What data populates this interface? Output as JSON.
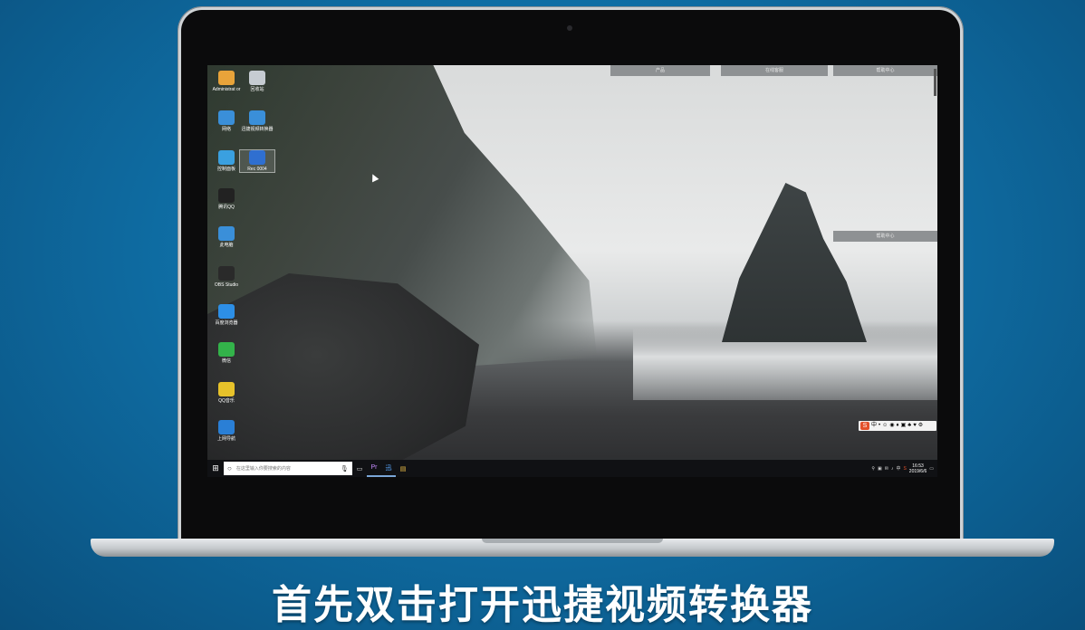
{
  "desktop_icons": [
    {
      "label": "Administrat or",
      "color": "#e8a33a"
    },
    {
      "label": "回收站",
      "color": "#c6ccd2"
    },
    {
      "label": "网络",
      "color": "#3a8fd9"
    },
    {
      "label": "迅捷视频转换器",
      "color": "#3a8fd9"
    },
    {
      "label": "控制面板",
      "color": "#3aa0e0"
    },
    {
      "label": "Rec 0004",
      "color": "#2f6fd0"
    },
    {
      "label": "腾讯QQ",
      "color": "#222222"
    },
    {
      "label": "此电脑",
      "color": "#3a8fd9"
    },
    {
      "label": "OBS Studio",
      "color": "#2a2a2a"
    },
    {
      "label": "百度浏览器",
      "color": "#2d8fe6"
    },
    {
      "label": "微信",
      "color": "#33b34a"
    },
    {
      "label": "QQ音乐",
      "color": "#e7c22a"
    },
    {
      "label": "上网导航",
      "color": "#2a7fd6"
    }
  ],
  "top_panels": [
    "产品",
    "在线客服",
    "帮助中心"
  ],
  "side_panel": "帮助中心",
  "ime": {
    "logo": "S",
    "items": [
      "中",
      "•",
      "☺",
      "◉",
      "♦",
      "▣",
      "♣",
      "♥",
      "⚙"
    ]
  },
  "taskbar": {
    "search_placeholder": "在这里输入你要搜索的内容",
    "apps": [
      "▭",
      "Pr",
      "迅",
      "▤"
    ],
    "tray_items": [
      "⚲",
      "▣",
      "✉",
      "♪",
      "中",
      "S"
    ],
    "time": "16:53",
    "date": "2019/6/6"
  },
  "subtitle": "首先双击打开迅捷视频转换器"
}
